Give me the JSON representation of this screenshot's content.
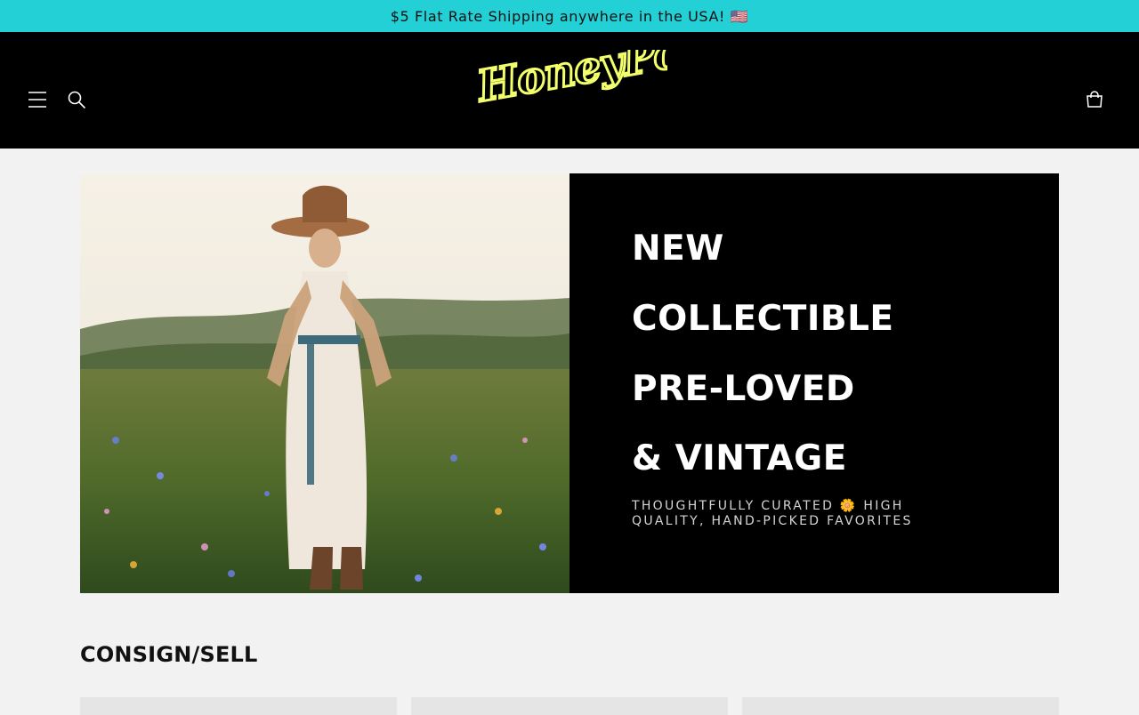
{
  "announcement": {
    "text": "$5 Flat Rate Shipping anywhere in the USA! 🇺🇸"
  },
  "header": {
    "logo_text": "HoneyPot",
    "icons": {
      "menu": "menu-icon",
      "search": "search-icon",
      "cart": "cart-icon"
    }
  },
  "hero": {
    "lines": [
      "NEW",
      "COLLECTIBLE",
      "PRE-LOVED",
      "& VINTAGE"
    ],
    "subtitle": "THOUGHTFULLY CURATED 🌼 HIGH QUALITY, HAND-PICKED FAVORITES"
  },
  "section": {
    "title": "CONSIGN/SELL"
  },
  "colors": {
    "announcement_bg": "#22d0d6",
    "header_bg": "#000000",
    "logo": "#f2ff6a",
    "page_bg": "#f2f2f2"
  }
}
